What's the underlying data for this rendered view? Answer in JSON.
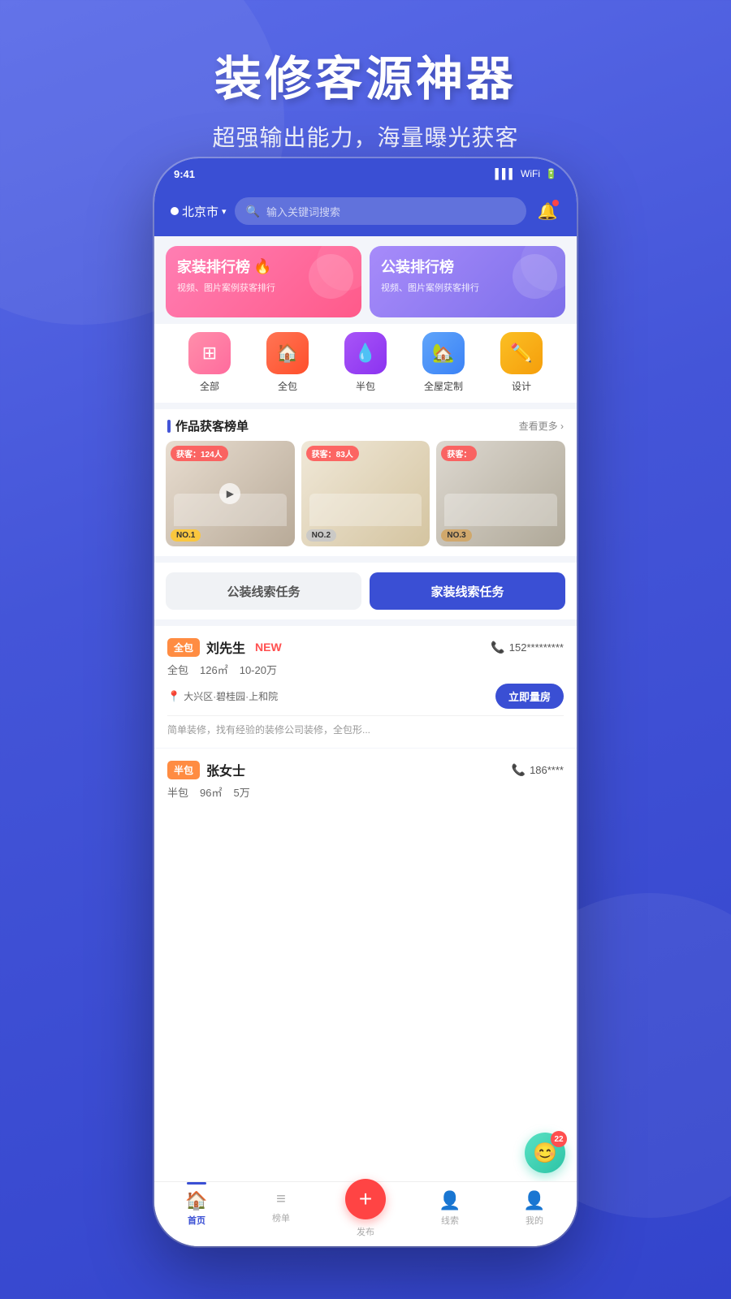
{
  "hero": {
    "title": "装修客源神器",
    "subtitle": "超强输出能力，海量曝光获客"
  },
  "header": {
    "location": "北京市",
    "search_placeholder": "输入关键词搜索",
    "location_icon": "●",
    "chevron": "▾"
  },
  "banners": [
    {
      "title": "家装排行榜",
      "fire": "🔥",
      "subtitle": "视频、图片案例获客排行",
      "type": "jiazhuang"
    },
    {
      "title": "公装排行榜",
      "subtitle": "视频、图片案例获客排行",
      "type": "gongzhuang"
    }
  ],
  "categories": [
    {
      "label": "全部",
      "icon": "⊞",
      "color": "pink"
    },
    {
      "label": "全包",
      "icon": "🏠",
      "color": "red"
    },
    {
      "label": "半包",
      "icon": "💧",
      "color": "purple"
    },
    {
      "label": "全屋定制",
      "icon": "🏡",
      "color": "blue"
    },
    {
      "label": "设计",
      "icon": "✏️",
      "color": "orange"
    }
  ],
  "works_section": {
    "title": "作品获客榜单",
    "more": "查看更多 ›"
  },
  "works": [
    {
      "badge": "获客：124人",
      "rank": "NO.1",
      "rank_type": "gold"
    },
    {
      "badge": "获客：83人",
      "rank": "NO.2",
      "rank_type": "silver"
    },
    {
      "badge": "获客：",
      "rank": "NO.3",
      "rank_type": "bronze"
    }
  ],
  "tabs": [
    {
      "label": "公装线索任务",
      "active": false
    },
    {
      "label": "家装线索任务",
      "active": true
    }
  ],
  "leads": [
    {
      "type_label": "全包",
      "type_class": "badge-quanbao",
      "name": "刘先生",
      "is_new": true,
      "new_label": "NEW",
      "phone": "152*********",
      "detail_type": "全包",
      "area": "126㎡",
      "budget": "10-20万",
      "location": "大兴区·碧桂园·上和院",
      "action_btn": "立即量房",
      "desc": "简单装修，找有经验的装修公司装修，全包形..."
    },
    {
      "type_label": "半包",
      "type_class": "badge-banbao",
      "name": "张女士",
      "is_new": false,
      "new_label": "",
      "phone": "186****",
      "detail_type": "半包",
      "area": "96㎡",
      "budget": "5万",
      "location": "",
      "action_btn": "",
      "desc": ""
    }
  ],
  "bottom_nav": [
    {
      "label": "首页",
      "icon": "🏠",
      "active": true
    },
    {
      "label": "榜单",
      "icon": "≡",
      "active": false
    },
    {
      "label": "发布",
      "icon": "+",
      "active": false,
      "is_publish": true
    },
    {
      "label": "线索",
      "icon": "👤",
      "active": false
    },
    {
      "label": "我的",
      "icon": "👤",
      "active": false
    }
  ],
  "chat": {
    "badge": "22"
  }
}
